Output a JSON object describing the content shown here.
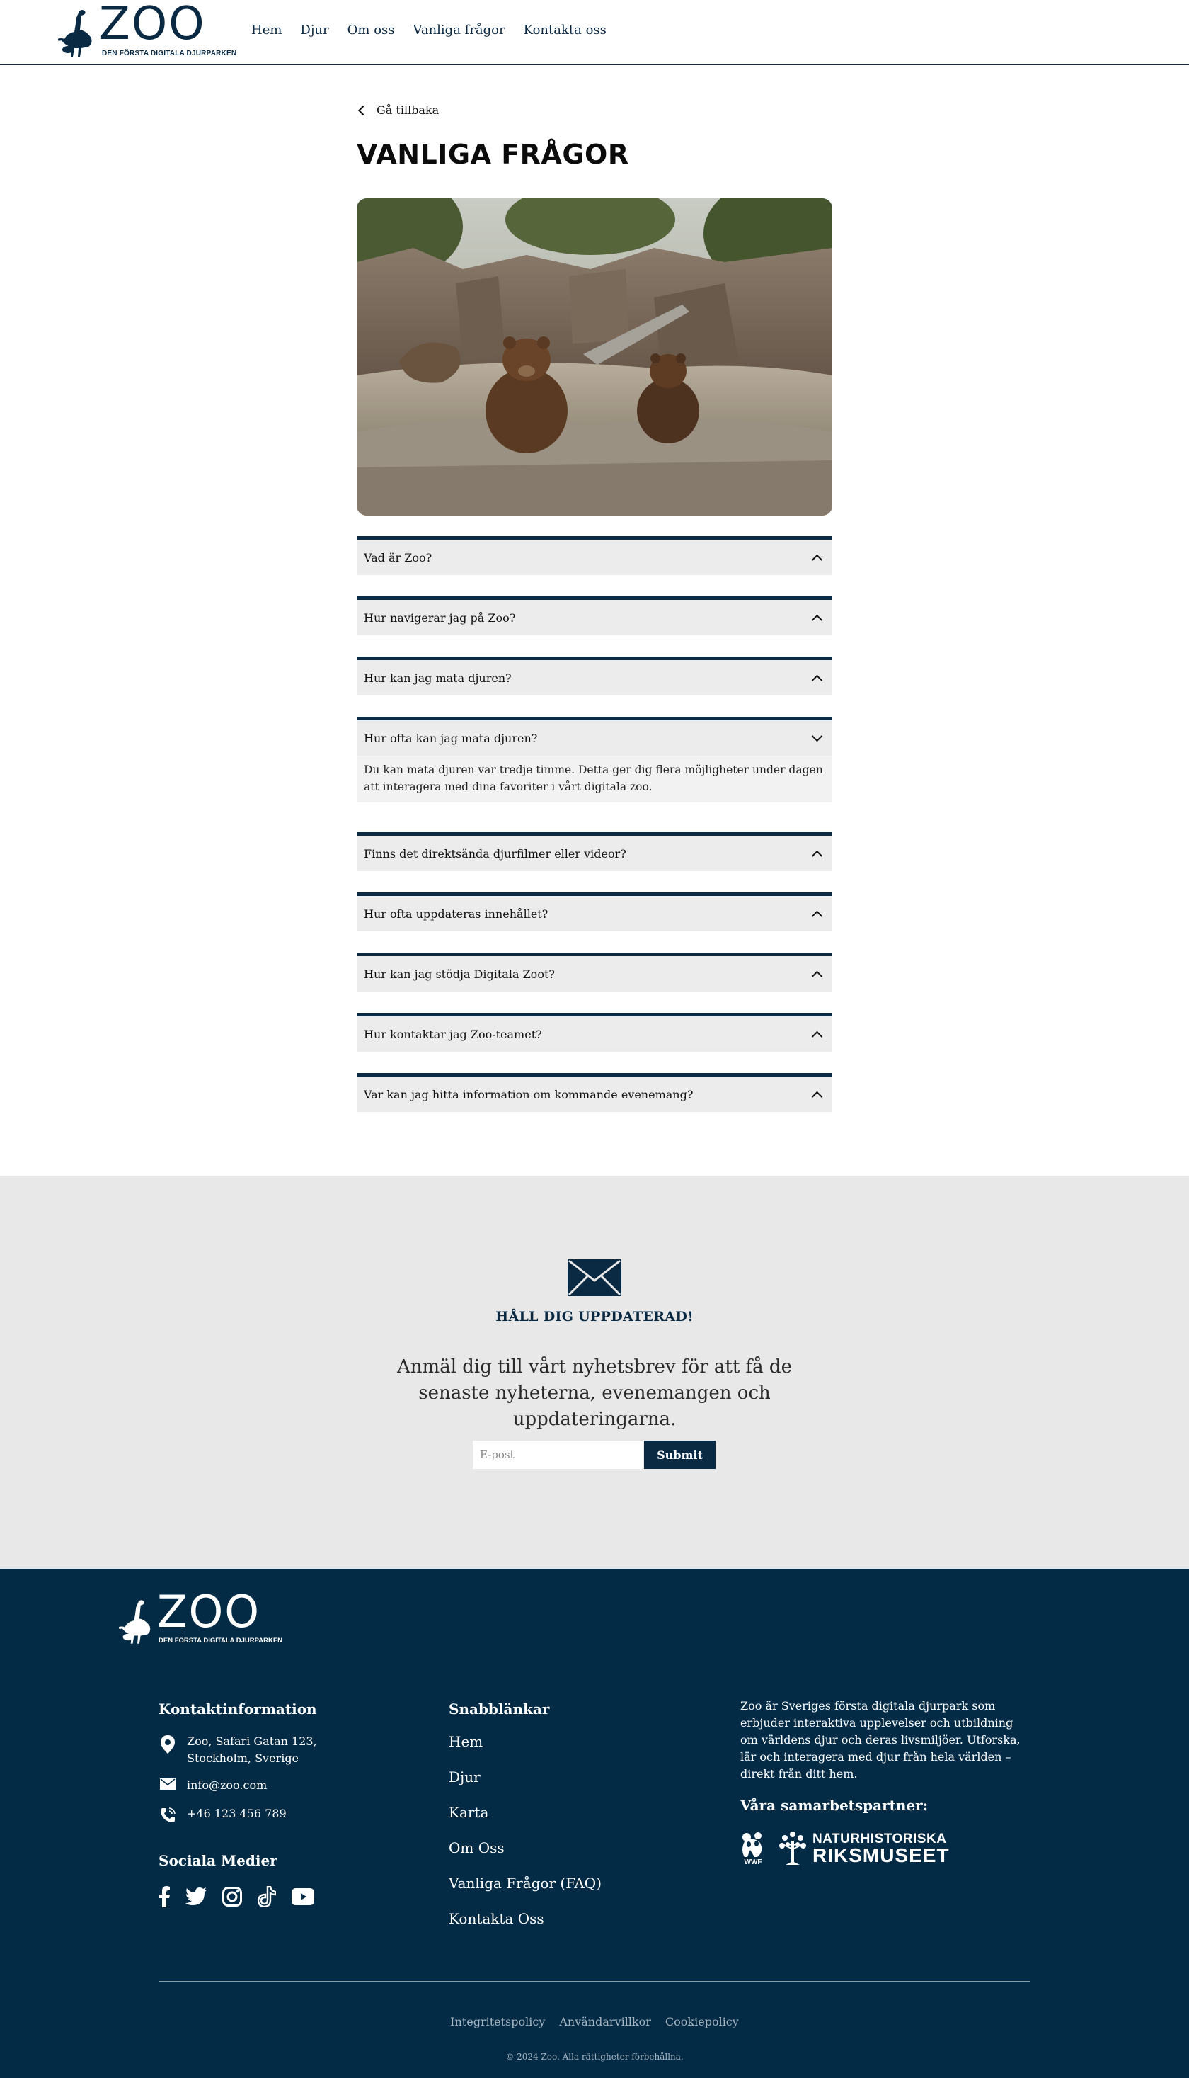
{
  "header": {
    "logo_text": "ZOO",
    "logo_tagline": "DEN FÖRSTA DIGITALA DJURPARKEN",
    "nav": [
      "Hem",
      "Djur",
      "Om oss",
      "Vanliga frågor",
      "Kontakta oss"
    ]
  },
  "main": {
    "back_label": "Gå tillbaka",
    "title": "VANLIGA FRÅGOR",
    "faq": [
      {
        "question": "Vad är Zoo?",
        "open": false
      },
      {
        "question": "Hur navigerar jag på Zoo?",
        "open": false
      },
      {
        "question": "Hur kan jag mata djuren?",
        "open": false
      },
      {
        "question": "Hur ofta kan jag mata djuren?",
        "open": true,
        "answer": "Du kan mata djuren var tredje timme. Detta ger dig flera möjligheter under dagen att interagera med dina favoriter i vårt digitala zoo."
      },
      {
        "question": "Finns det direktsända djurfilmer eller videor?",
        "open": false
      },
      {
        "question": "Hur ofta uppdateras innehållet?",
        "open": false
      },
      {
        "question": "Hur kan jag stödja Digitala Zoot?",
        "open": false
      },
      {
        "question": "Hur kontaktar jag Zoo-teamet?",
        "open": false
      },
      {
        "question": "Var kan jag hitta information om kommande evenemang?",
        "open": false
      }
    ]
  },
  "newsletter": {
    "title": "HÅLL DIG UPPDATERAD!",
    "text": "Anmäl dig till vårt nyhetsbrev för att få de senaste nyheterna, evenemangen och uppdateringarna.",
    "email_placeholder": "E-post",
    "submit_label": "Submit"
  },
  "footer": {
    "logo_text": "ZOO",
    "logo_tagline": "DEN FÖRSTA DIGITALA DJURPARKEN",
    "contact_heading": "Kontaktinformation",
    "address_line1": "Zoo, Safari Gatan 123,",
    "address_line2": "Stockholm, Sverige",
    "email": "info@zoo.com",
    "phone": "+46 123 456 789",
    "social_heading": "Sociala Medier",
    "quick_heading": "Snabblänkar",
    "quick_links": [
      "Hem",
      "Djur",
      "Karta",
      "Om Oss",
      "Vanliga Frågor (FAQ)",
      "Kontakta Oss"
    ],
    "about": "Zoo är Sveriges första digitala djurpark som erbjuder interaktiva upplevelser och utbildning om världens djur och deras livsmiljöer. Utforska, lär och interagera med djur från hela världen – direkt från ditt hem.",
    "partners_heading": "Våra samarbetspartner:",
    "partner_wwf": "WWF",
    "partner_nhm_line1": "NATURHISTORISKA",
    "partner_nhm_line2": "RIKSMUSEET",
    "legal_links": [
      "Integritetspolicy",
      "Användarvillkor",
      "Cookiepolicy"
    ],
    "copyright": "© 2024 Zoo. Alla rättigheter förbehållna."
  },
  "colors": {
    "brand_navy": "#032b45",
    "faq_bar": "#0b2b45",
    "newsletter_bg": "#e8e8e8"
  }
}
